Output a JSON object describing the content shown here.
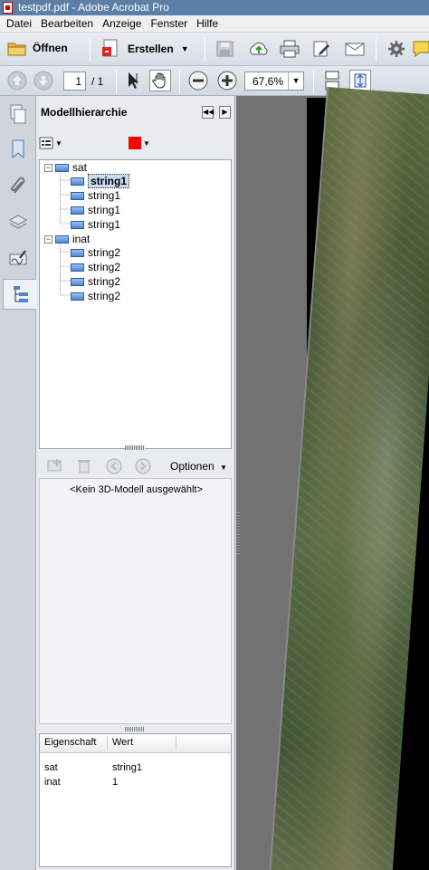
{
  "window": {
    "title": "testpdf.pdf - Adobe Acrobat Pro"
  },
  "menu": [
    "Datei",
    "Bearbeiten",
    "Anzeige",
    "Fenster",
    "Hilfe"
  ],
  "toolbar": {
    "open_label": "Öffnen",
    "create_label": "Erstellen"
  },
  "nav": {
    "page_current": "1",
    "page_total": "/ 1",
    "zoom": "67,6%"
  },
  "panel": {
    "title": "Modellhierarchie",
    "color_swatch": "#ff0000",
    "tree": {
      "group1": {
        "label": "sat",
        "children": [
          "string1",
          "string1",
          "string1",
          "string1"
        ]
      },
      "group2": {
        "label": "inat",
        "children": [
          "string2",
          "string2",
          "string2",
          "string2"
        ]
      }
    },
    "options_label": "Optionen",
    "no_model_text": "<Kein 3D-Modell ausgewählt>",
    "props": {
      "headers": [
        "Eigenschaft",
        "Wert"
      ],
      "rows": [
        {
          "key": "sat",
          "value": "string1"
        },
        {
          "key": "inat",
          "value": "1"
        }
      ]
    }
  }
}
